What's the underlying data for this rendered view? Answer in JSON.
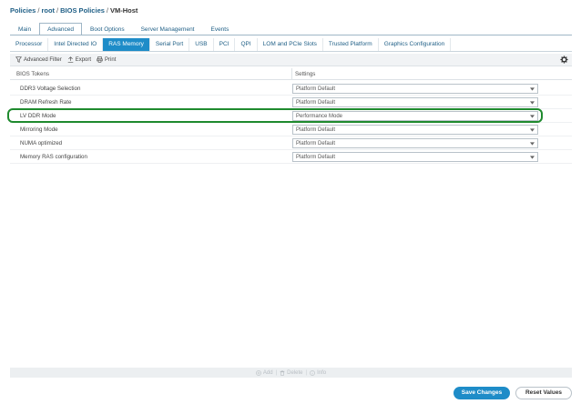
{
  "breadcrumb": {
    "items": [
      "Policies",
      "root",
      "BIOS Policies"
    ],
    "current": "VM-Host",
    "separator": "/"
  },
  "tabs_primary": [
    {
      "label": "Main",
      "active": false
    },
    {
      "label": "Advanced",
      "active": true
    },
    {
      "label": "Boot Options",
      "active": false
    },
    {
      "label": "Server Management",
      "active": false
    },
    {
      "label": "Events",
      "active": false
    }
  ],
  "tabs_secondary": [
    {
      "label": "Processor",
      "active": false
    },
    {
      "label": "Intel Directed IO",
      "active": false
    },
    {
      "label": "RAS Memory",
      "active": true
    },
    {
      "label": "Serial Port",
      "active": false
    },
    {
      "label": "USB",
      "active": false
    },
    {
      "label": "PCI",
      "active": false
    },
    {
      "label": "QPI",
      "active": false
    },
    {
      "label": "LOM and PCIe Slots",
      "active": false
    },
    {
      "label": "Trusted Platform",
      "active": false
    },
    {
      "label": "Graphics Configuration",
      "active": false
    }
  ],
  "toolbar": {
    "filter_label": "Advanced Filter",
    "export_label": "Export",
    "print_label": "Print"
  },
  "grid": {
    "col_tokens": "BIOS Tokens",
    "col_settings": "Settings",
    "rows": [
      {
        "token": "DDR3 Voltage Selection",
        "setting": "Platform Default"
      },
      {
        "token": "DRAM Refresh Rate",
        "setting": "Platform Default"
      },
      {
        "token": "LV DDR Mode",
        "setting": "Performance Mode",
        "highlighted": true
      },
      {
        "token": "Mirroring Mode",
        "setting": "Platform Default"
      },
      {
        "token": "NUMA optimized",
        "setting": "Platform Default"
      },
      {
        "token": "Memory RAS configuration",
        "setting": "Platform Default"
      }
    ]
  },
  "footer": {
    "add_label": "Add",
    "delete_label": "Delete",
    "info_label": "Info"
  },
  "buttons": {
    "save_label": "Save Changes",
    "reset_label": "Reset Values"
  },
  "colors": {
    "accent": "#1e8cc8",
    "link": "#1f5f86",
    "highlight": "#1f8a2e"
  }
}
